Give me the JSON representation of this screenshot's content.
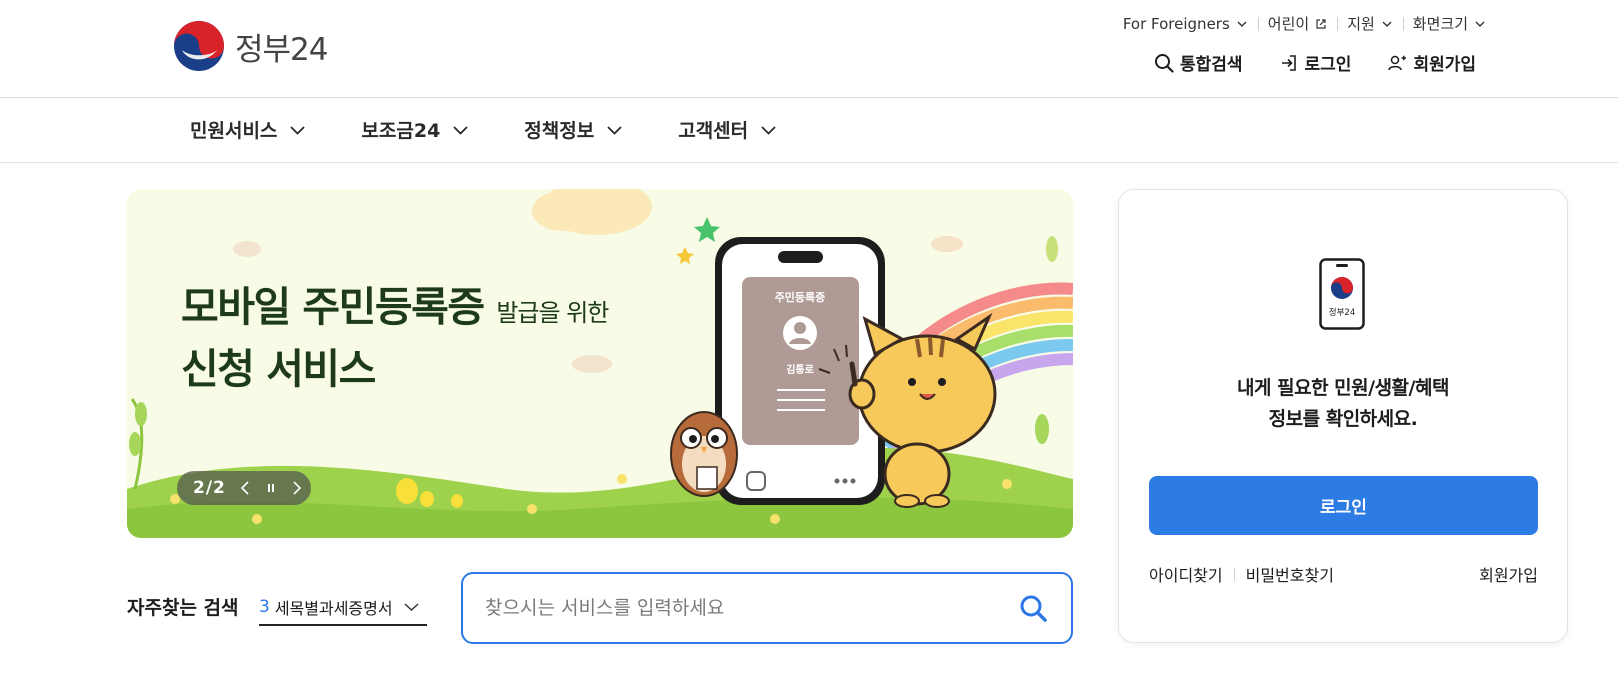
{
  "header": {
    "logo_text": "정부24",
    "util": [
      {
        "label": "For Foreigners",
        "icon": "chevron-down-icon"
      },
      {
        "label": "어린이",
        "icon": "external-link-icon"
      },
      {
        "label": "지원",
        "icon": "chevron-down-icon"
      },
      {
        "label": "화면크기",
        "icon": "chevron-down-icon"
      }
    ],
    "main_links": [
      {
        "label": "통합검색",
        "icon": "search-icon"
      },
      {
        "label": "로그인",
        "icon": "login-icon"
      },
      {
        "label": "회원가입",
        "icon": "user-plus-icon"
      }
    ]
  },
  "gnb": [
    "민원서비스",
    "보조금24",
    "정책정보",
    "고객센터"
  ],
  "banner": {
    "title_line1": "모바일 주민등록증",
    "title_line1_small": "발급을 위한",
    "title_line2": "신청 서비스",
    "card_title": "주민등록증",
    "card_name": "김통로",
    "slide_counter": "2/2"
  },
  "search": {
    "freq_label": "자주찾는 검색",
    "freq_rank": "3",
    "freq_term": "세목별과세증명서",
    "placeholder": "찾으시는 서비스를 입력하세요"
  },
  "login_card": {
    "icon_text": "정부24",
    "message_line1": "내게 필요한 민원/생활/혜택",
    "message_line2": "정보를 확인하세요.",
    "login_button": "로그인",
    "find_id": "아이디찾기",
    "find_password": "비밀번호찾기",
    "signup": "회원가입"
  },
  "colors": {
    "accent": "#2d7be5",
    "banner_bg": "#f8fbe6",
    "banner_title": "#1d3a1a"
  }
}
